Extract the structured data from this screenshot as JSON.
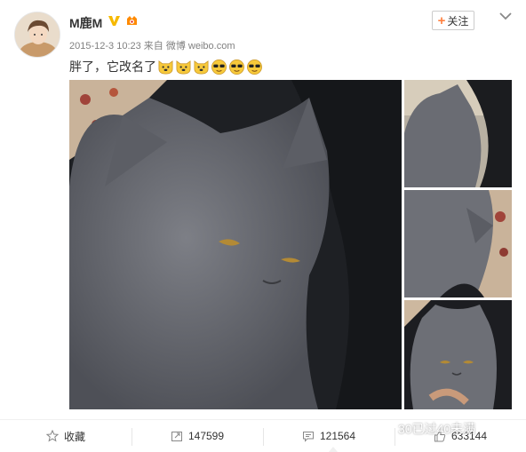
{
  "post": {
    "username": "M鹿M",
    "verified_icon": "verified-v-icon",
    "vip_icon": "vip-badge-icon",
    "timestamp": "2015-12-3 10:23",
    "source_prefix": "来自",
    "source": "微博 weibo.com",
    "follow_label": "关注",
    "text": "胖了，它改名了",
    "emoji": [
      "dog-face-emoji",
      "dog-face-emoji",
      "dog-face-emoji",
      "sunglasses-emoji",
      "sunglasses-emoji",
      "sunglasses-emoji"
    ]
  },
  "photos": {
    "main": "gray-cat-closeup",
    "thumbs": [
      "gray-cat-back",
      "gray-cat-side",
      "gray-cat-face"
    ]
  },
  "actions": {
    "favorite_label": "收藏",
    "repost_count": "147599",
    "comment_count": "121564",
    "like_count": "633144"
  },
  "watermark": {
    "text": "30已过40未满",
    "icon": "wechat-icon"
  },
  "colors": {
    "accent": "#ff8140",
    "text": "#333333",
    "meta": "#808080",
    "verified": "#f6b900"
  }
}
